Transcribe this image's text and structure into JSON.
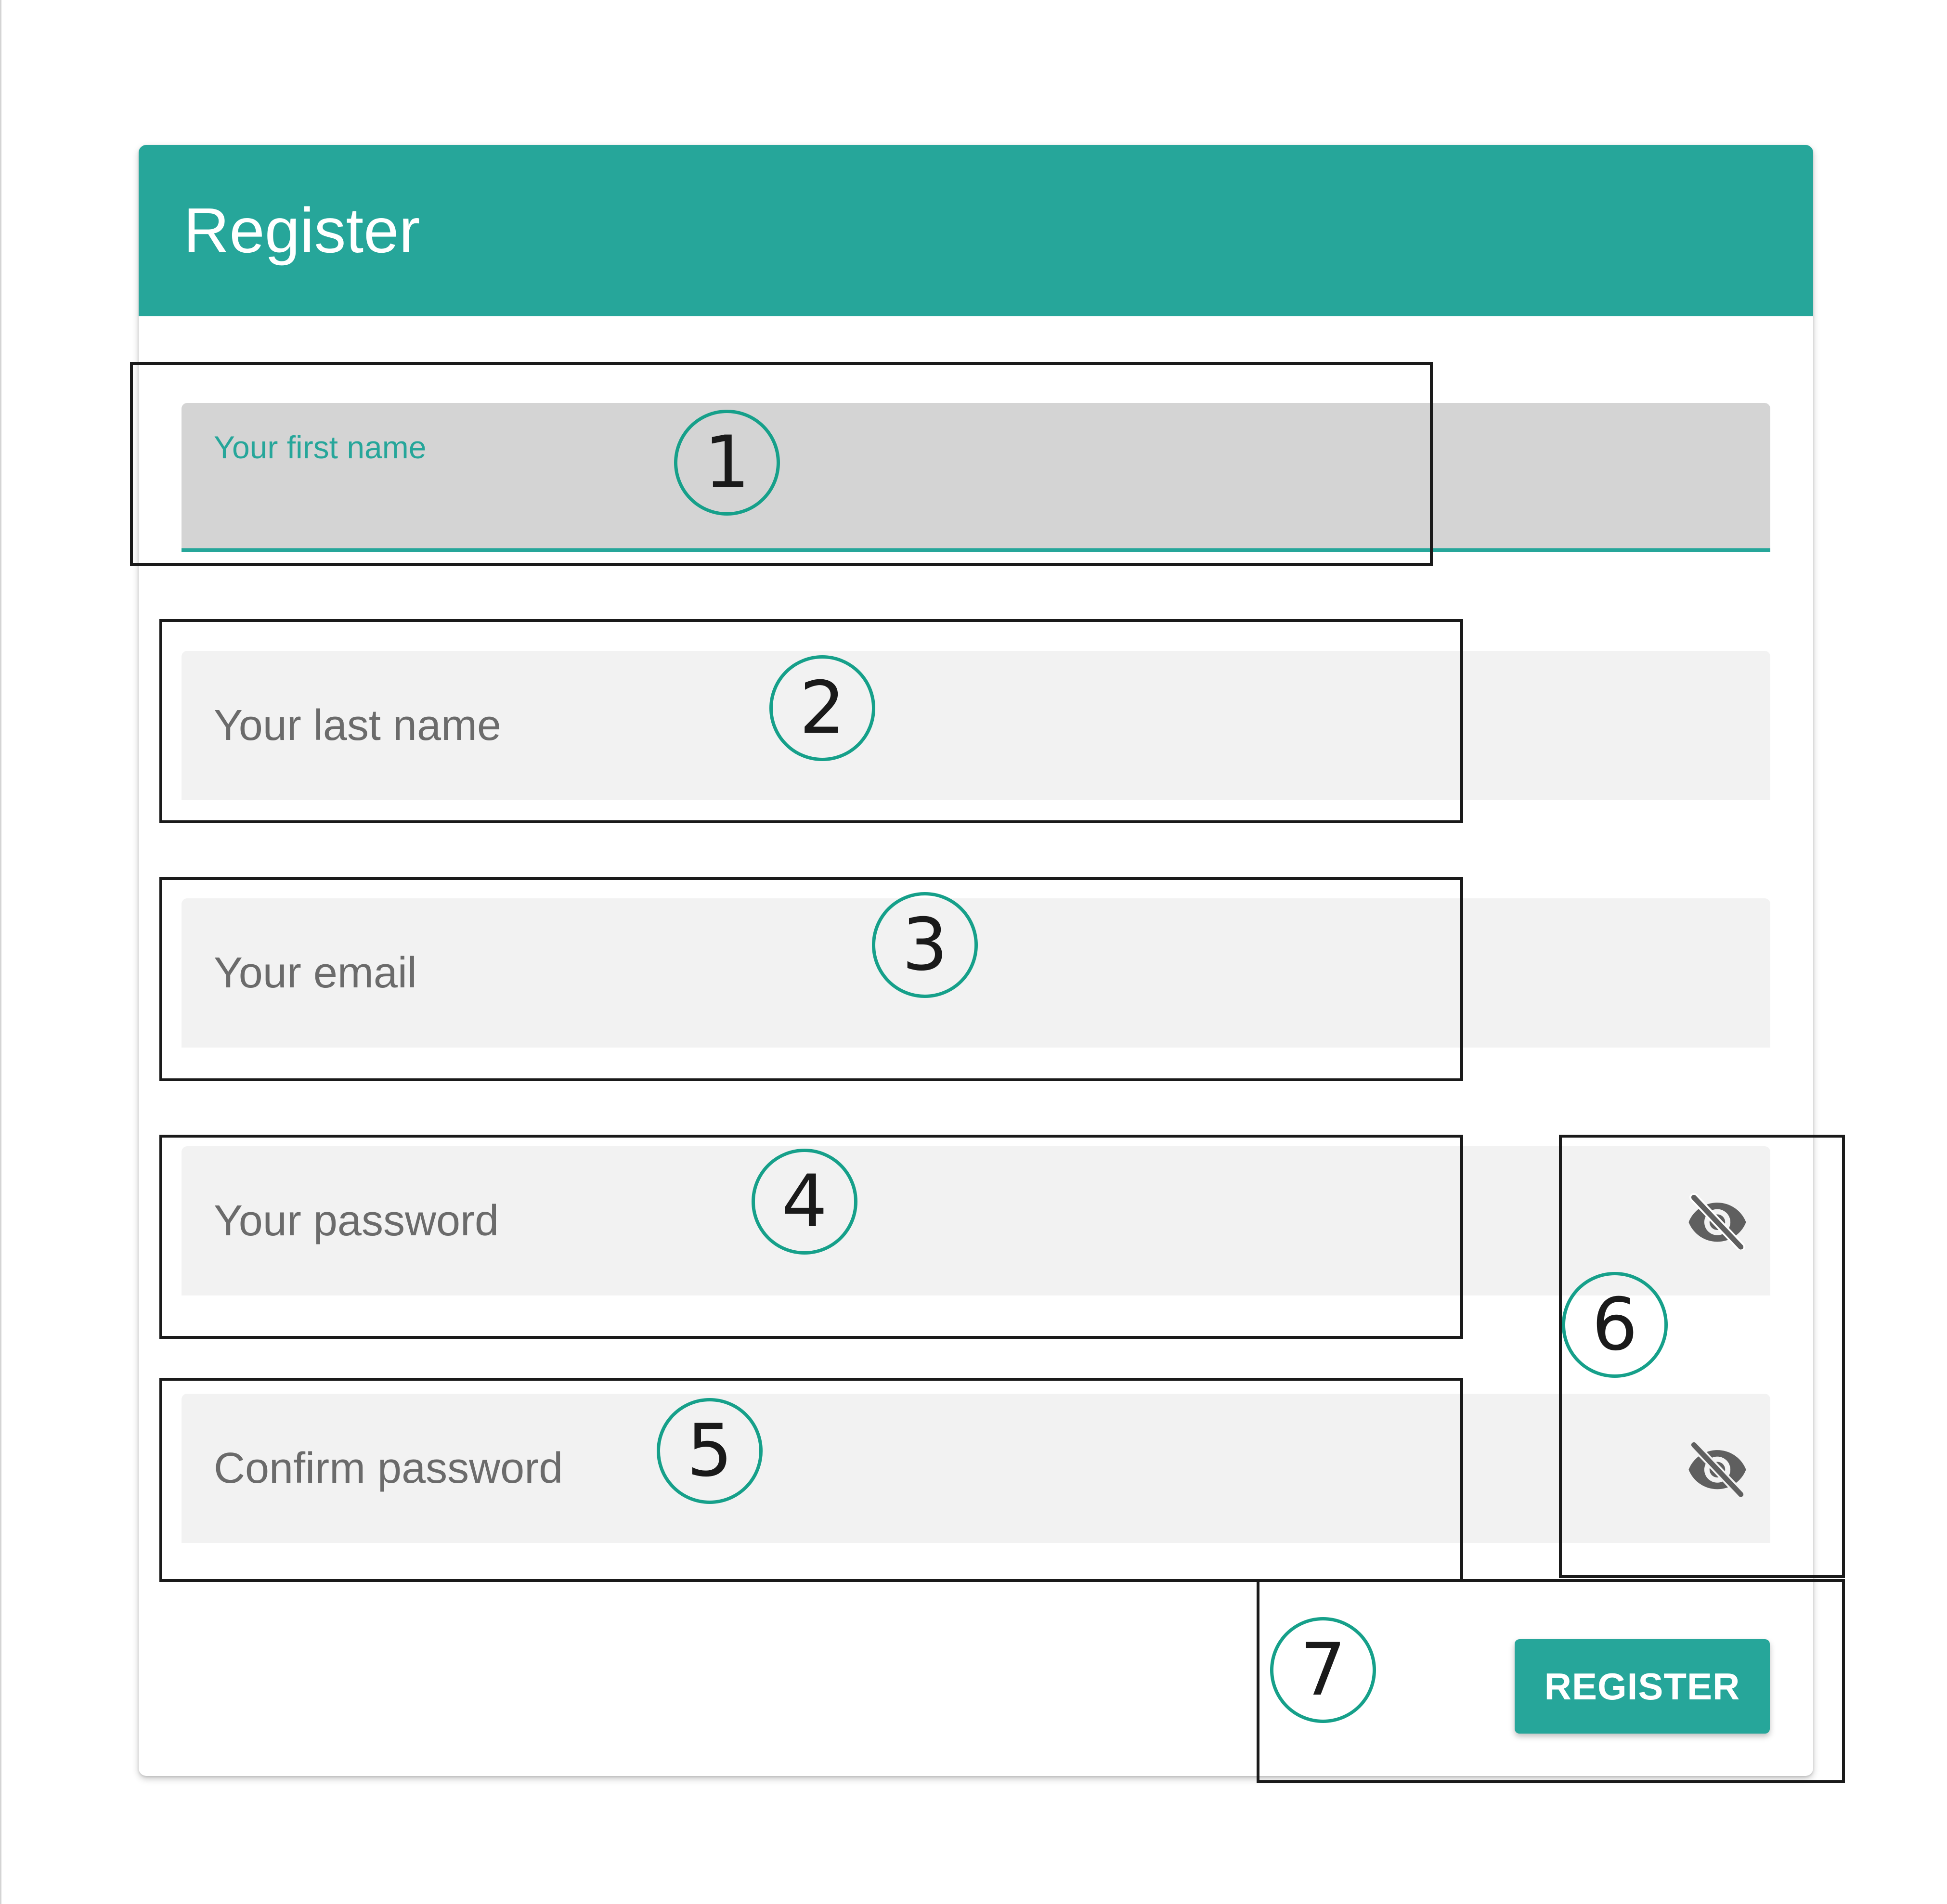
{
  "card": {
    "title": "Register"
  },
  "form": {
    "first_name_label": "Your first name",
    "last_name_placeholder": "Your last name",
    "email_placeholder": "Your email",
    "password_placeholder": "Your password",
    "confirm_password_placeholder": "Confirm password",
    "submit_label": "REGISTER"
  },
  "icons": {
    "password_toggle": "eye-off-icon",
    "confirm_password_toggle": "eye-off-icon"
  },
  "annotations": [
    "1",
    "2",
    "3",
    "4",
    "5",
    "6",
    "7"
  ],
  "colors": {
    "accent": "#26a69a",
    "annotation_circle": "#16a08a",
    "field_bg": "#f2f2f2",
    "focused_field_bg": "#d4d4d4"
  }
}
